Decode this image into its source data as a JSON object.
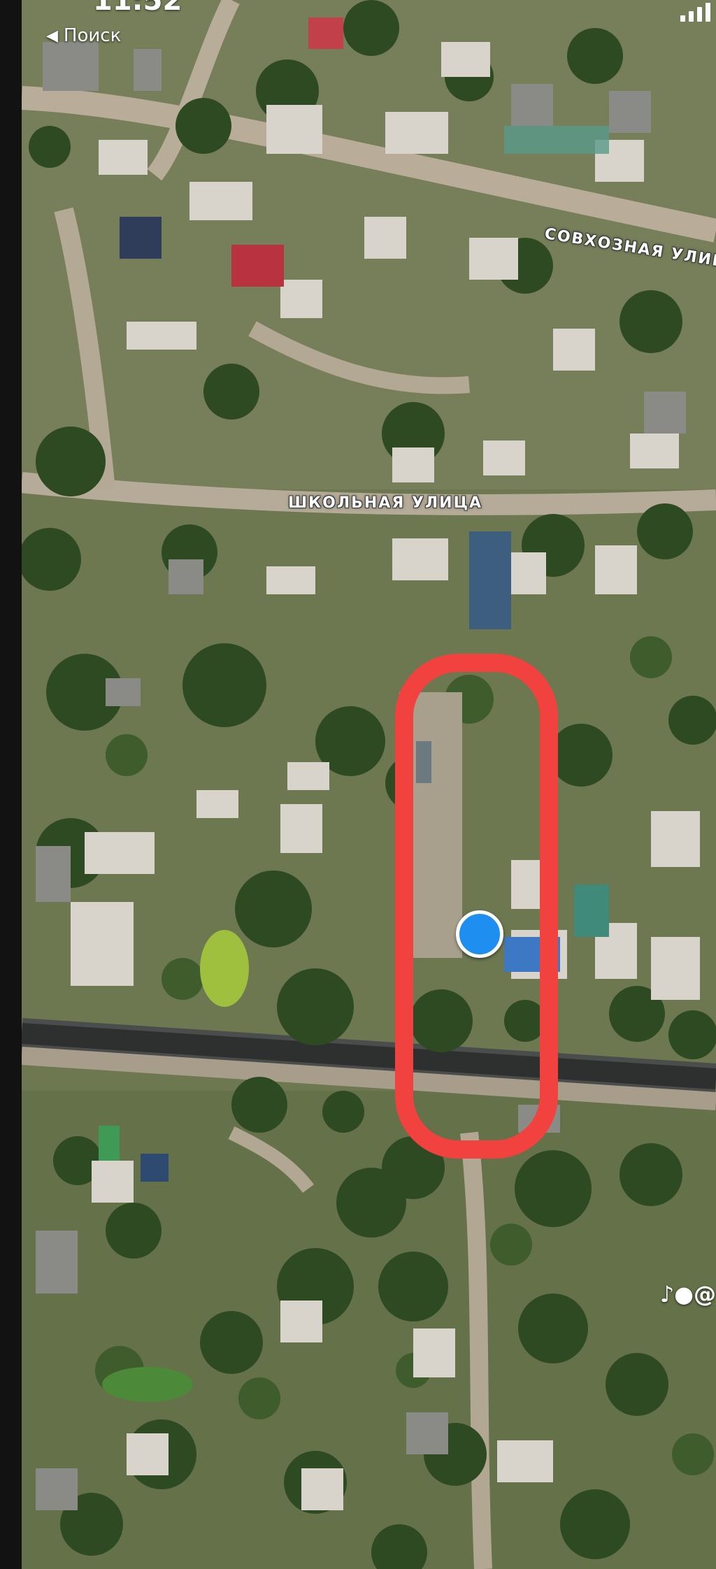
{
  "status_bar": {
    "time": "11:52"
  },
  "nav": {
    "back_label": "Поиск",
    "back_icon": "chevron-left-icon"
  },
  "map": {
    "streets": [
      "СОВХОЗНАЯ УЛИЦ",
      "ШКОЛЬНАЯ УЛИЦА"
    ]
  },
  "overlay": {
    "highlight_color": "#f2423f",
    "marker_color": "#1f8ef1"
  },
  "watermark": {
    "icons": [
      "tiktok-icon",
      "person-icon"
    ],
    "text": "@"
  }
}
